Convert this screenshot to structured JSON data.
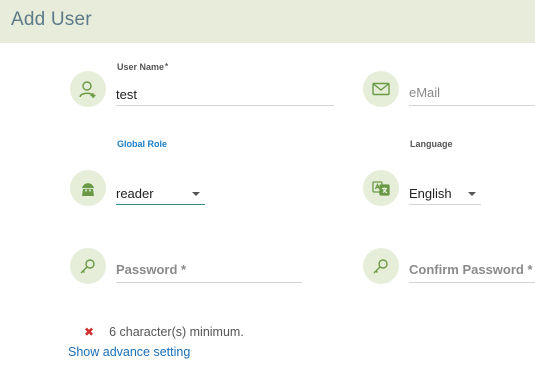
{
  "header": {
    "title": "Add User"
  },
  "form": {
    "username": {
      "label": "User Name",
      "required_mark": "*",
      "value": "test"
    },
    "email": {
      "placeholder": "eMail"
    },
    "global_role": {
      "label": "Global Role",
      "selected": "reader"
    },
    "language": {
      "label": "Language",
      "selected": "English"
    },
    "password": {
      "placeholder": "Password *"
    },
    "confirm_password": {
      "placeholder": "Confirm Password *"
    }
  },
  "validation": {
    "icon": "x-mark-icon",
    "message": "6 character(s) minimum."
  },
  "advanced_link": {
    "label": "Show advance setting"
  },
  "colors": {
    "header_bg": "#e8ecda",
    "icon_bg": "#e6eeda",
    "icon_fg": "#6b9a45",
    "link": "#1a6fb8",
    "error": "#d0312d"
  }
}
